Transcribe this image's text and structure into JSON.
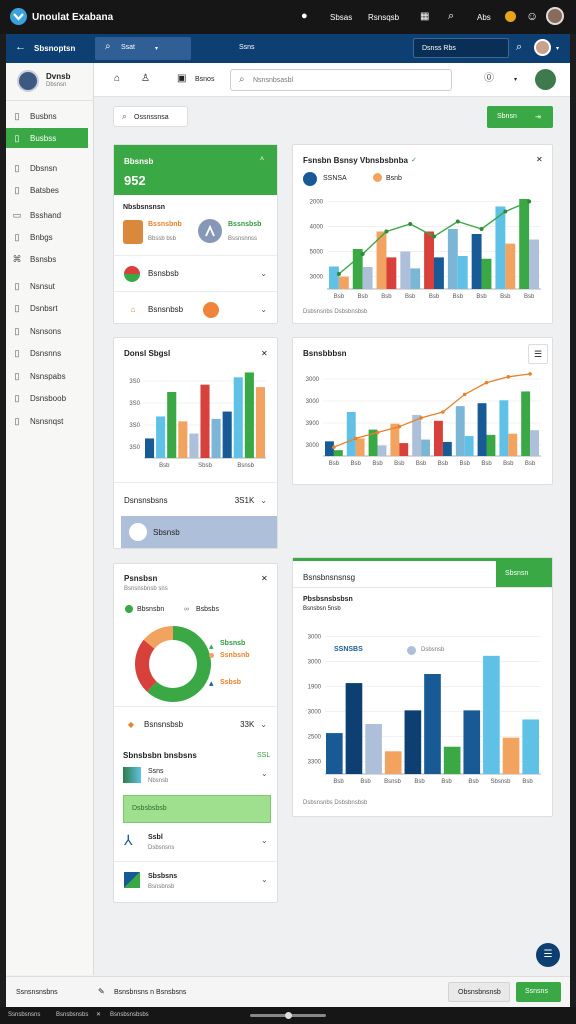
{
  "top": {
    "title": "Unoulat Exabana",
    "link1": "Sbsas",
    "link2": "Rsnsqsb",
    "link3": "Abs"
  },
  "appbar": {
    "module": "Sbsnoptsn",
    "search_placeholder": "Ssat",
    "center": "Ssns",
    "search2": "Dsnss Rbs"
  },
  "sidebar": {
    "user": {
      "name": "Dvnsb",
      "sub": "Dbsnsn"
    },
    "items": [
      {
        "label": "Busbns",
        "icon": "doc-icon"
      },
      {
        "label": "Busbss",
        "icon": "doc-icon"
      },
      {
        "label": "Dbsnsn",
        "icon": "doc-icon"
      },
      {
        "label": "Batsbes",
        "icon": "doc-icon"
      },
      {
        "label": "Bsshand",
        "icon": "folder-icon"
      },
      {
        "label": "Bnbgs",
        "icon": "doc-icon"
      },
      {
        "label": "Bsnsbs",
        "icon": "link-icon"
      },
      {
        "label": "Nsnsut",
        "icon": "doc-icon"
      },
      {
        "label": "Dsnbsrt",
        "icon": "doc-icon"
      },
      {
        "label": "Nsnsons",
        "icon": "doc-icon"
      },
      {
        "label": "Dsnsnns",
        "icon": "doc-icon"
      },
      {
        "label": "Nsnspabs",
        "icon": "doc-icon"
      },
      {
        "label": "Dsnsboob",
        "icon": "doc-icon"
      },
      {
        "label": "Nsnsnqst",
        "icon": "doc-icon"
      }
    ]
  },
  "toolbar": {
    "btn": "Bsnos",
    "search_placeholder": "Nsnsnbsasbl"
  },
  "filter": {
    "label": "Ossnssnsa",
    "button": "Sbnsn"
  },
  "kpi": {
    "title": "Bbsnsb",
    "value": "952",
    "sub": "Nbsbsnsnsn",
    "left_value": "Bssnsbnb",
    "left_sub": "Bbssb bsb",
    "right_value": "Bssnsbsb",
    "right_sub": "Bssnsnnss",
    "row1": "Bsnsbsb",
    "row2": "Bsnsnbsb"
  },
  "bar1": {
    "title": "Fsnsbn Bsnsy Vbnsbsbnba",
    "legend1": "SSNSA",
    "legend2": "Bsnb",
    "footer": "Dsbsnsnbs Dsbsbnsbsb"
  },
  "bar2": {
    "title": "Donsl Sbgsl",
    "row1": "Dsnsnsbsns",
    "row1_val": "3S1K",
    "row2": "Sbsnsb"
  },
  "combo": {
    "title": "Bsnsbbbsn"
  },
  "pie": {
    "title": "Psnsbsn",
    "sub": "Bsnsnsbnsb sns",
    "leg1": "Bbsnsbn",
    "leg2": "Bsbsbs",
    "val1": "Sbsnsb",
    "val2": "Ssnbsnb",
    "val3": "Ssbsb",
    "row1": "Bsnsnsbsb",
    "row1_val": "33K",
    "sec": "Sbnsbsbn bnsbsns",
    "sec_val": "SSL",
    "r1a": "Ssns",
    "r1b": "Nbsnsb",
    "r2": "Dsbsbsbsb",
    "r3a": "Ssbl",
    "r3b": "Dsbsnsns",
    "r4a": "Sbsbsns",
    "r4b": "Bsnsbnsb"
  },
  "big": {
    "title": "Bsnsbnsnsnsg",
    "tag": "Sbsnsn",
    "sub": "Pbsbsnsbsbsn",
    "sub2": "Bsnsbsn 5nsb",
    "leg1": "SSNSBS",
    "leg2": "Dsbsnsb",
    "footer": "Dsbsnsnbs Dsbsbnsbsb"
  },
  "footer": {
    "left": "Ssnsnsnsbns",
    "mid": "Bsnsbnsns n Bsnsbsns",
    "cancel": "Obsnsbnsnsb",
    "ok": "Ssnsns"
  },
  "bottom": {
    "a": "Ssnsbsnsns",
    "b": "Bsnsbsnsbs",
    "c": "Bsnsbsnsbsbs"
  },
  "colors": {
    "accent": "#39a845",
    "navy": "#0e3f73",
    "blue": "#175a96",
    "sky": "#5fc1e6",
    "orange": "#f2a35f"
  },
  "chart_data": [
    {
      "type": "bar",
      "title": "Fsnsbn Bsnsy Vbnsbsbnba",
      "ylim": [
        0,
        4000
      ],
      "yticks": [
        "3000",
        "5000",
        "4000",
        "2000"
      ],
      "categories": [
        "Bsb",
        "Bsb",
        "Bsb",
        "Bsb",
        "Bsb",
        "Bsb",
        "Bsb",
        "Bsb",
        "Bsb"
      ],
      "series": [
        {
          "name": "SSNSA",
          "values": [
            600,
            1400,
            2300,
            2600,
            2100,
            2700,
            2400,
            3100,
            3500
          ]
        },
        {
          "name": "Bsnb",
          "values": [
            900,
            1600,
            2300,
            1500,
            2300,
            2400,
            2200,
            3300,
            3600
          ]
        }
      ]
    },
    {
      "type": "bar",
      "title": "Donsl Sbgsl",
      "ylim": [
        0,
        3600
      ],
      "yticks": [
        "3S0",
        "3S0",
        "3S0",
        "3S0"
      ],
      "categories": [
        "Bsb",
        "Sbsb",
        "Bsnsb"
      ],
      "values": [
        800,
        1700,
        2700,
        1500,
        1000,
        3000,
        1600,
        1900,
        3300,
        3500,
        2900
      ]
    },
    {
      "type": "bar",
      "title": "Bsnsbbbsn",
      "ylim": [
        0,
        3000
      ],
      "yticks": [
        "3000",
        "3900",
        "3000",
        "3000"
      ],
      "categories": [
        "Bsb",
        "Bsb",
        "Bsb",
        "Bsb",
        "Bsb",
        "Bsb",
        "Bsb",
        "Bsb",
        "Bsb",
        "Bsb"
      ],
      "series": [
        {
          "values": [
            500,
            1500,
            900,
            1100,
            1400,
            1200,
            1700,
            1800,
            1900,
            2200
          ]
        },
        {
          "values": [
            300,
            600,
            800,
            1000,
            1300,
            1500,
            2100,
            2500,
            2700,
            2800
          ]
        }
      ]
    },
    {
      "type": "pie",
      "title": "Psnsbsn",
      "slices": [
        {
          "label": "Bbsnsbn",
          "value": 62
        },
        {
          "label": "Bsbsbs",
          "value": 24
        },
        {
          "label": "Ssbsb",
          "value": 14
        }
      ]
    },
    {
      "type": "bar",
      "title": "Bsnsbnsnsnsg",
      "ylim": [
        0,
        3300
      ],
      "yticks": [
        "3300",
        "2500",
        "3000",
        "1900",
        "3000",
        "3000"
      ],
      "categories": [
        "Bsb",
        "Bsb",
        "Bsnsb",
        "Bsb",
        "Bsb",
        "Bsb",
        "Sbsnsb",
        "Bsb"
      ],
      "values": [
        900,
        2000,
        1100,
        500,
        1400,
        2200,
        600,
        1400,
        2600,
        800,
        1200
      ]
    }
  ]
}
